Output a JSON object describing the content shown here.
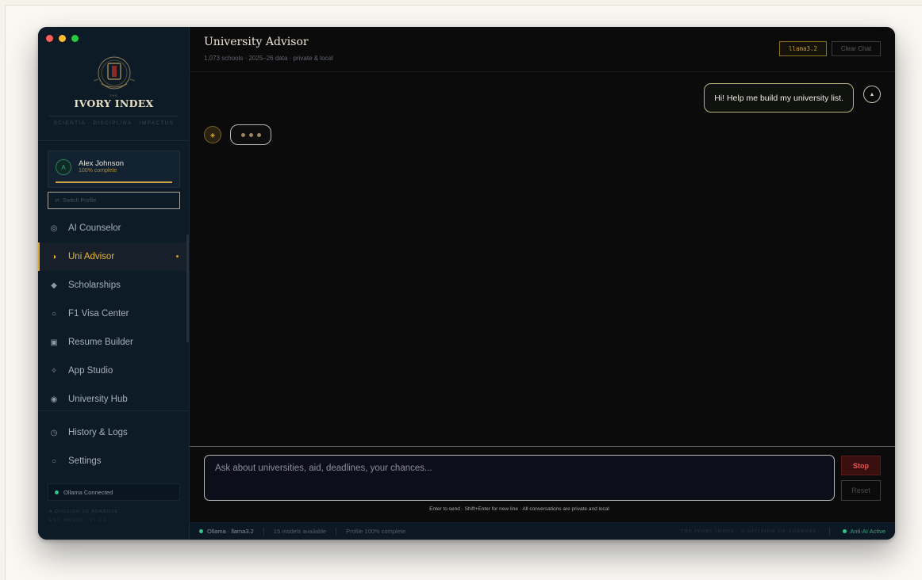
{
  "sidebar": {
    "logo_text": "IVORY INDEX",
    "logo_small": "THE",
    "tagline": "SCIENTIA · DISCIPLINA · IMPACTUS",
    "profile": {
      "initial": "A",
      "name": "Alex Johnson",
      "completion_text": "100% complete",
      "completion": 1.0
    },
    "switch_profile": "Switch Profile",
    "switch_icon": "⇄",
    "nav": [
      {
        "label": "AI Counselor",
        "icon": "◎"
      },
      {
        "label": "Uni Advisor",
        "icon": "◑",
        "active": true
      },
      {
        "label": "Scholarships",
        "icon": "◆"
      },
      {
        "label": "F1 Visa Center",
        "icon": "○"
      },
      {
        "label": "Resume Builder",
        "icon": "▣"
      },
      {
        "label": "App Studio",
        "icon": "✧"
      },
      {
        "label": "University Hub",
        "icon": "◉"
      }
    ],
    "nav_secondary": [
      {
        "label": "History & Logs",
        "icon": "◷"
      },
      {
        "label": "Settings",
        "icon": "○"
      }
    ],
    "ollama_status": "Ollama Connected",
    "division": "A DIVISION OF ADAROSE",
    "est": "EST. MMXXV · V1.0.0"
  },
  "header": {
    "title": "University Advisor",
    "subtitle": "1,073 schools · 2025–26 data · private & local",
    "model": "llama3.2",
    "clear_label": "Clear Chat"
  },
  "chat": {
    "messages": [
      {
        "role": "user",
        "text": "Hi! Help me build my university list.",
        "avatar": "▲"
      }
    ],
    "bot_avatar": "◈"
  },
  "composer": {
    "placeholder": "Ask about universities, aid, deadlines, your chances...",
    "stop_label": "Stop",
    "reset_label": "Reset",
    "hint": "Enter to send · Shift+Enter for new line · All conversations are private and local"
  },
  "statusbar": {
    "model": "Ollama · llama3.2",
    "models_available": "15 models available",
    "profile": "Profile 100% complete",
    "brand": "THE IVORY INDEX · A DIVISION OF ADAROSE",
    "anti_ai": "Anti-AI Active"
  },
  "colors": {
    "accent_gold": "#e6b739",
    "sidebar_bg": "#0d1b27",
    "status_green": "#2fc48a",
    "stop_red": "#e25656"
  }
}
